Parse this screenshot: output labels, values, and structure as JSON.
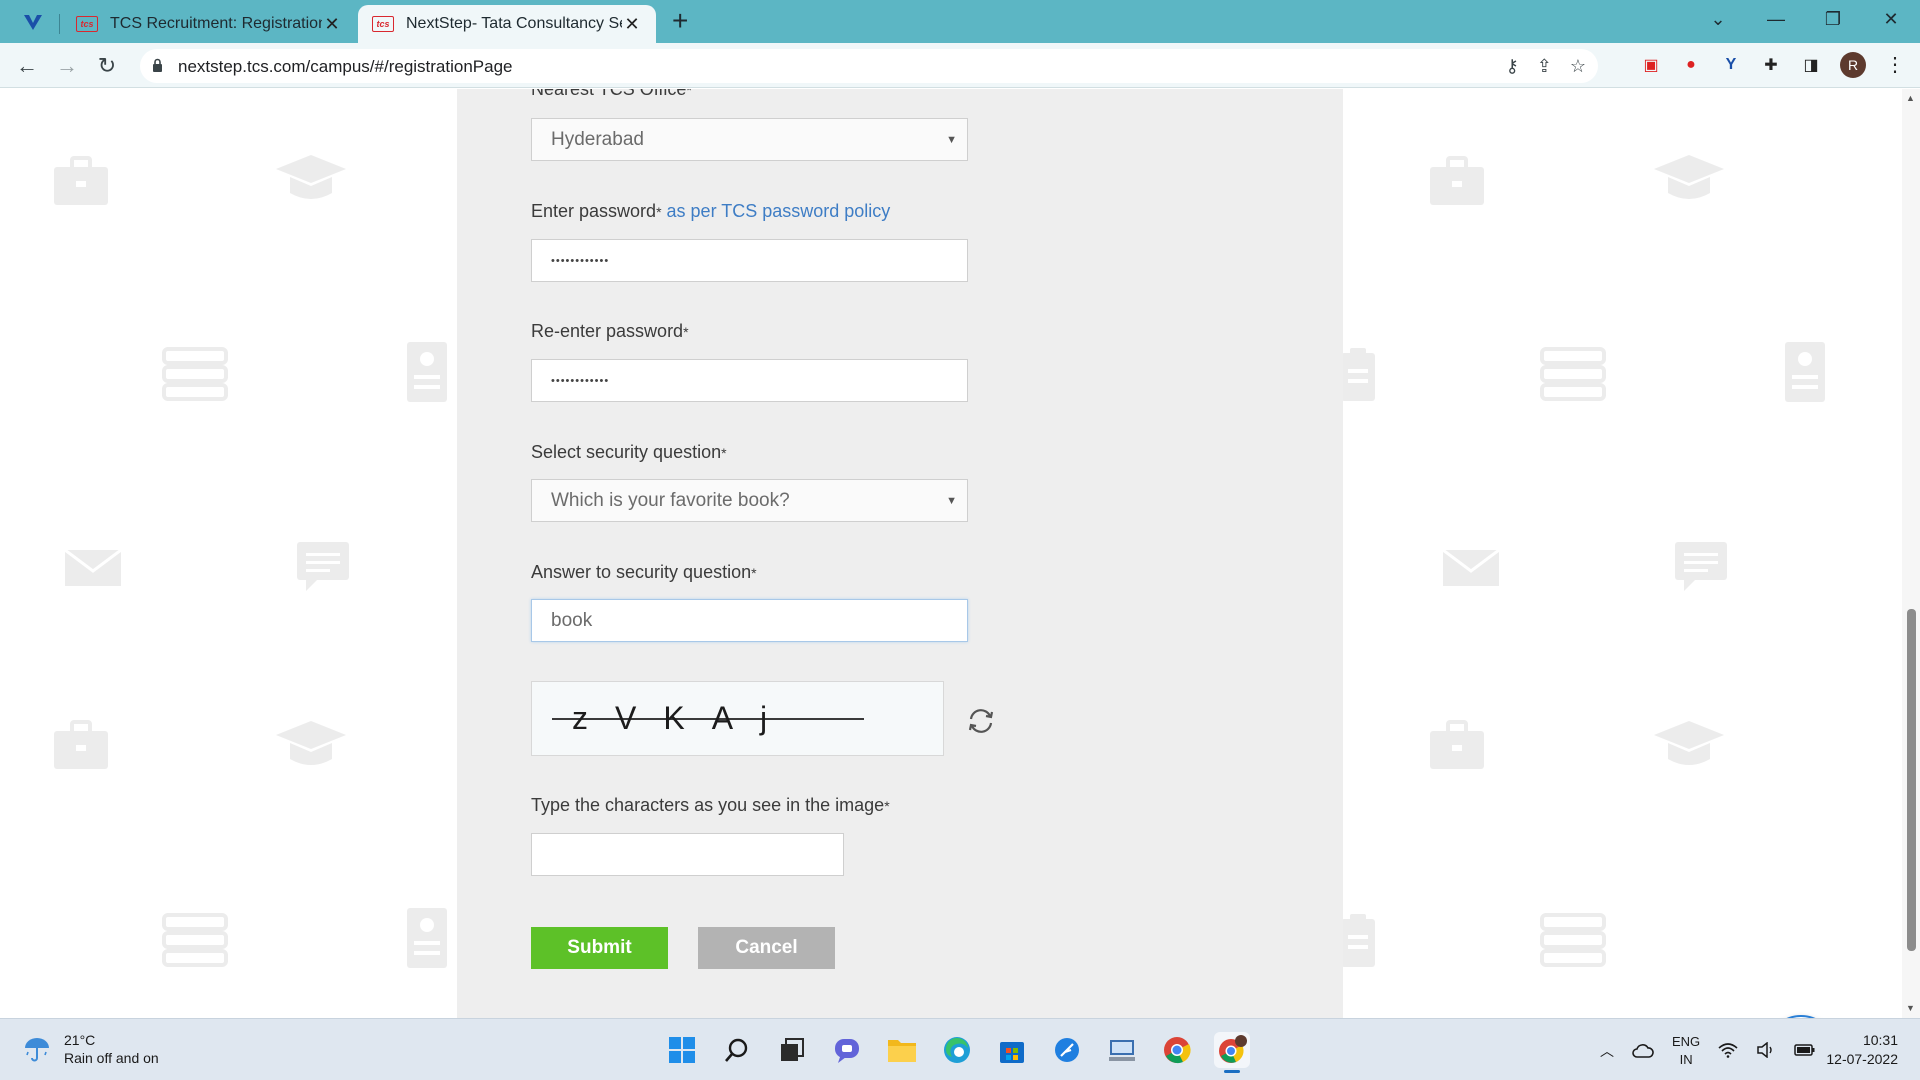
{
  "browser": {
    "tabs": [
      {
        "title": "TCS Recruitment: Registrations O",
        "active": false
      },
      {
        "title": "NextStep- Tata Consultancy Servi",
        "active": true
      }
    ],
    "url": "nextstep.tcs.com/campus/#/registrationPage",
    "avatar_letter": "R",
    "favicon_text": "tcs"
  },
  "form": {
    "office_label": "Nearest TCS Office",
    "office_value": "Hyderabad",
    "password_label": "Enter password",
    "password_policy_link": "as per TCS password policy",
    "password_mask": "••••••••••••",
    "reenter_label": "Re-enter password",
    "reenter_mask": "••••••••••••",
    "question_label": "Select security question",
    "question_value": "Which is your favorite book?",
    "answer_label": "Answer to security question",
    "answer_value": "book",
    "captcha_text": "zVKAj",
    "captcha_input_label": "Type the characters as you see in the image",
    "required_mark": "*",
    "submit_label": "Submit",
    "cancel_label": "Cancel"
  },
  "taskbar": {
    "temperature": "21°C",
    "weather": "Rain off and on",
    "lang_top": "ENG",
    "lang_bottom": "IN",
    "time": "10:31",
    "date": "12-07-2022"
  },
  "colors": {
    "tabstrip": "#5cb6c4",
    "submit": "#5dc128",
    "cancel": "#b3b3b3",
    "link": "#3e7dc5"
  }
}
